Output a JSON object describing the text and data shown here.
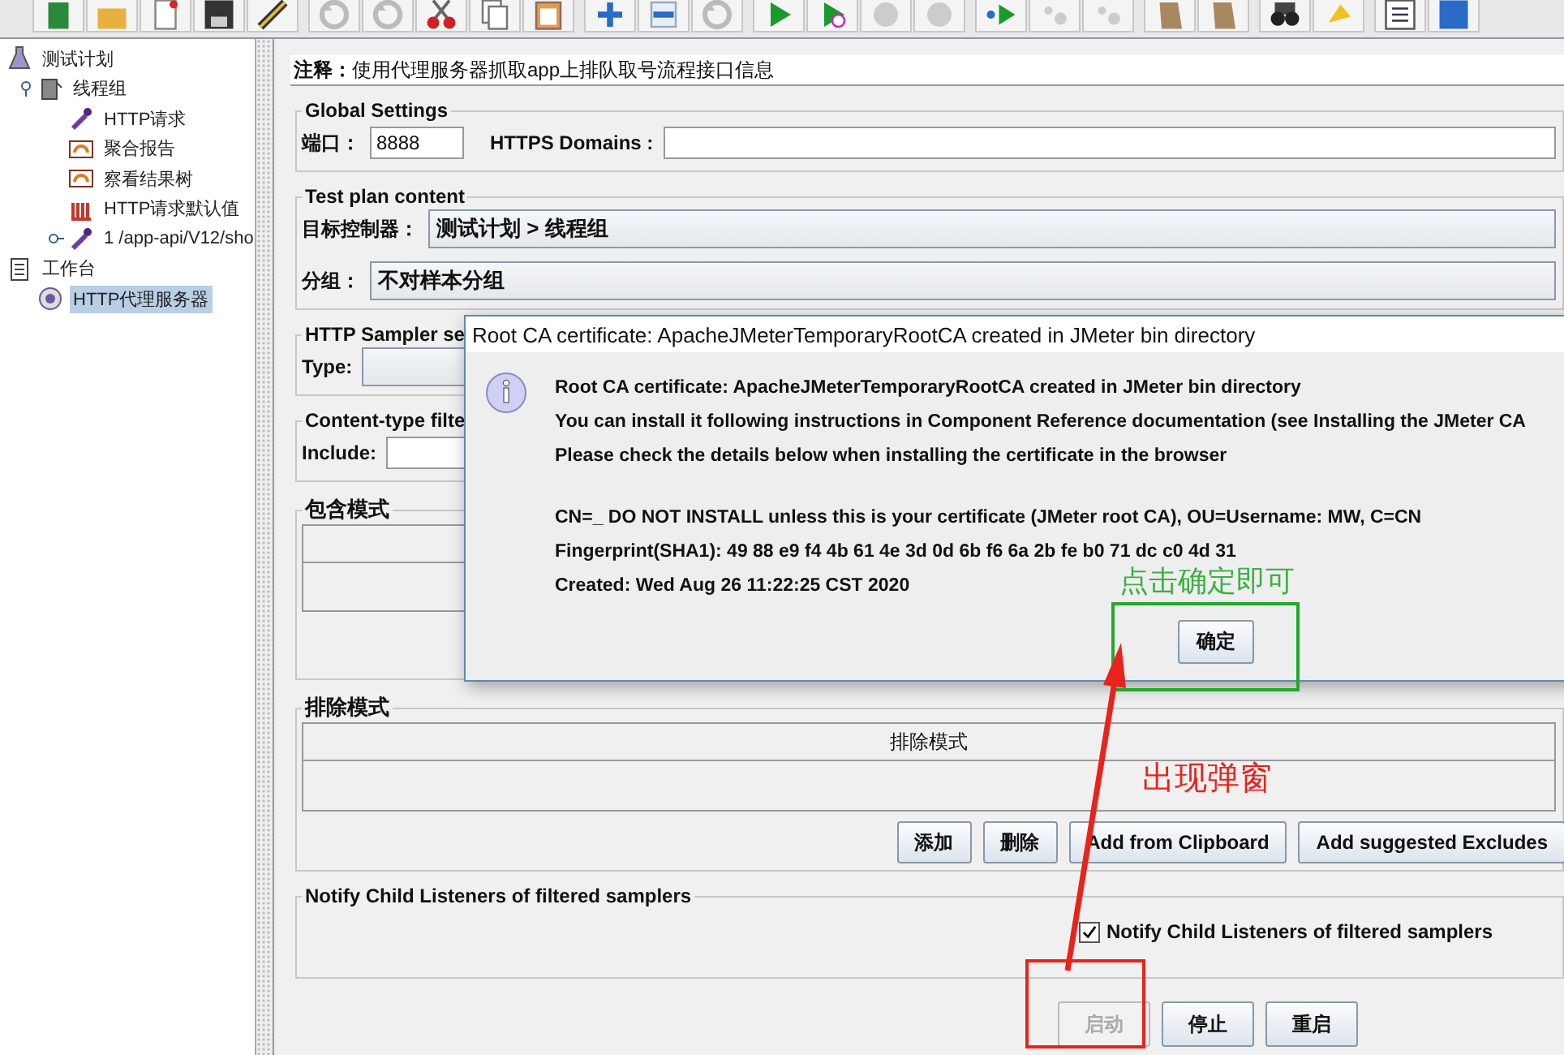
{
  "tree": [
    {
      "label": "测试计划",
      "kind": "plan",
      "selected": false,
      "children": [
        {
          "label": "线程组",
          "kind": "threads",
          "selected": false,
          "expanded": true,
          "children": [
            {
              "label": "HTTP请求",
              "kind": "sampler",
              "selected": false
            },
            {
              "label": "聚合报告",
              "kind": "listener",
              "selected": false
            },
            {
              "label": "察看结果树",
              "kind": "listener",
              "selected": false
            },
            {
              "label": "HTTP请求默认值",
              "kind": "config",
              "selected": false
            },
            {
              "label": "1 /app-api/V12/sho",
              "kind": "sampler",
              "selected": false,
              "expanded": false
            }
          ]
        }
      ]
    },
    {
      "label": "工作台",
      "kind": "workbench",
      "selected": false,
      "children": [
        {
          "label": "HTTP代理服务器",
          "kind": "proxy",
          "selected": true
        }
      ]
    }
  ],
  "comment": {
    "label": "注释：",
    "value": "使用代理服务器抓取app上排队取号流程接口信息"
  },
  "global_settings": {
    "title": "Global Settings",
    "port_label": "端口：",
    "port": "8888",
    "https_label": "HTTPS Domains :"
  },
  "test_plan_content": {
    "title": "Test plan content",
    "target_label": "目标控制器：",
    "target": "测试计划 > 线程组",
    "grouping_label": "分组：",
    "grouping": "不对样本分组"
  },
  "http_sampler": {
    "title": "HTTP Sampler se",
    "type_label": "Type:"
  },
  "content_filter": {
    "title": "Content-type filte",
    "include_label": "Include:"
  },
  "include_patterns": {
    "title": "包含模式"
  },
  "exclude_patterns": {
    "title": "排除模式",
    "column": "排除模式",
    "buttons": [
      "添加",
      "删除",
      "Add from Clipboard",
      "Add suggested Excludes"
    ]
  },
  "notify": {
    "title": "Notify Child Listeners of filtered samplers",
    "checkbox": {
      "label": "Notify Child Listeners of filtered samplers",
      "checked": true
    }
  },
  "actions": [
    {
      "label": "启动",
      "disabled": true
    },
    {
      "label": "停止",
      "disabled": false
    },
    {
      "label": "重启",
      "disabled": false
    }
  ],
  "dialog": {
    "title": "Root CA certificate: ApacheJMeterTemporaryRootCA created in JMeter bin directory",
    "lines": [
      "Root CA certificate: ApacheJMeterTemporaryRootCA created in JMeter bin directory",
      "You can install it following instructions in Component Reference documentation (see Installing the JMeter CA",
      "Please check the details below when installing the certificate in the browser",
      "CN=_ DO NOT INSTALL unless this is your certificate (JMeter root CA), OU=Username: MW, C=CN",
      "Fingerprint(SHA1): 49 88 e9 f4 4b 61 4e 3d 0d 6b f6 6a 2b fe b0 71 dc c0 4d 31",
      "Created: Wed Aug 26 11:22:25 CST 2020"
    ],
    "button": "确定"
  },
  "annotations": [
    {
      "kind": "box",
      "color": "#22a82a"
    },
    {
      "kind": "label",
      "text": "点击确定即可",
      "color": "#3cb043"
    },
    {
      "kind": "arrow",
      "color": "#e8231c"
    },
    {
      "kind": "label",
      "text": "出现弹窗",
      "color": "#e8231c"
    },
    {
      "kind": "box",
      "color": "#e8231c"
    }
  ]
}
